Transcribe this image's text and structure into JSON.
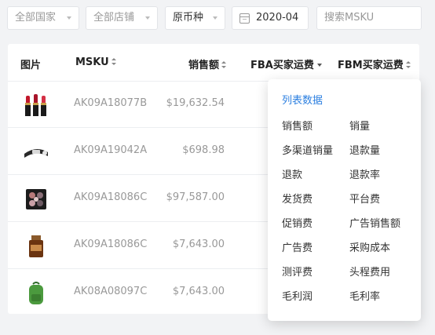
{
  "filters": {
    "country": "全部国家",
    "store": "全部店铺",
    "currency": "原币种",
    "date": "2020-04",
    "search_placeholder": "搜索MSKU"
  },
  "table": {
    "headers": {
      "image": "图片",
      "msku": "MSKU",
      "sales": "销售额",
      "fba_freight": "FBA买家运费",
      "fbm_freight": "FBM买家运费"
    },
    "rows": [
      {
        "image": "lipstick-set-icon",
        "msku": "AK09A18077B",
        "sales": "$19,632.54"
      },
      {
        "image": "headband-icon",
        "msku": "AK09A19042A",
        "sales": "$698.98"
      },
      {
        "image": "eyeshadow-palette-icon",
        "msku": "AK09A18086C",
        "sales": "$97,587.00"
      },
      {
        "image": "serum-bottle-icon",
        "msku": "AK09A18086C",
        "sales": "$7,643.00"
      },
      {
        "image": "backpack-icon",
        "msku": "AK08A08097C",
        "sales": "$7,643.00"
      }
    ]
  },
  "column_menu": {
    "title": "列表数据",
    "items": [
      [
        "销售额",
        "销量"
      ],
      [
        "多渠道销量",
        "退款量"
      ],
      [
        "退款",
        "退款率"
      ],
      [
        "发货费",
        "平台费"
      ],
      [
        "促销费",
        "广告销售额"
      ],
      [
        "广告费",
        "采购成本"
      ],
      [
        "测评费",
        "头程费用"
      ],
      [
        "毛利润",
        "毛利率"
      ]
    ]
  },
  "colors": {
    "accent": "#2b7fe0",
    "background": "#f2f3f5"
  }
}
